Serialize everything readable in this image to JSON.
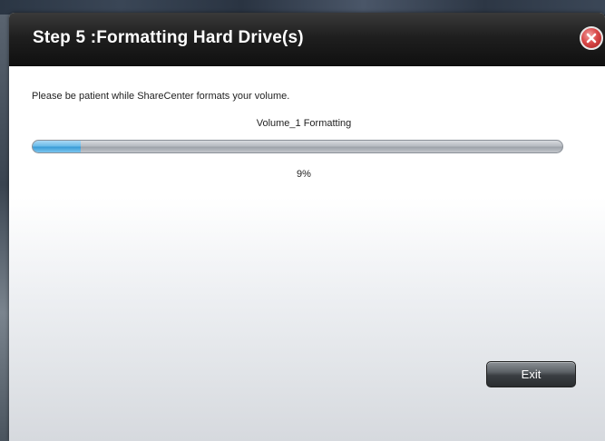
{
  "dialog": {
    "title": "Step 5 :Formatting Hard Drive(s)",
    "message": "Please be patient while ShareCenter formats your volume.",
    "progress": {
      "label": "Volume_1 Formatting",
      "percent_text": "9%",
      "value": 0.09
    },
    "exit_label": "Exit"
  },
  "colors": {
    "header_background": "#1a1a1a",
    "close_button": "#d94848",
    "progress_fill": "#4aa8de",
    "progress_track": "#b8bcc2"
  },
  "icons": {
    "close": "close-icon"
  }
}
